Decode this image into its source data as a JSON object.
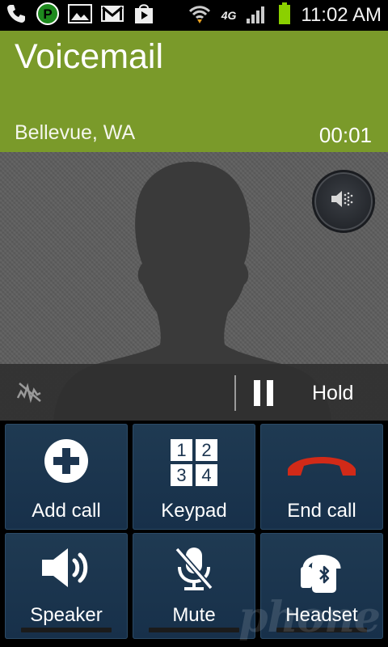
{
  "status_bar": {
    "time": "11:02 AM",
    "network_type": "4G",
    "icons": [
      "phone-icon",
      "parking-app-icon",
      "gallery-icon",
      "gmail-icon",
      "play-store-icon",
      "wifi-icon",
      "signal-icon",
      "battery-icon"
    ],
    "battery_color": "#8bd000"
  },
  "call": {
    "title": "Voicemail",
    "location": "Bellevue, WA",
    "duration": "00:01",
    "header_color": "#7a9a2a"
  },
  "hold_bar": {
    "hold_label": "Hold"
  },
  "buttons": {
    "add_call": "Add call",
    "keypad": "Keypad",
    "keypad_digits": [
      "1",
      "2",
      "3",
      "4"
    ],
    "end_call": "End call",
    "speaker": "Speaker",
    "mute": "Mute",
    "headset": "Headset"
  },
  "watermark": "phone"
}
